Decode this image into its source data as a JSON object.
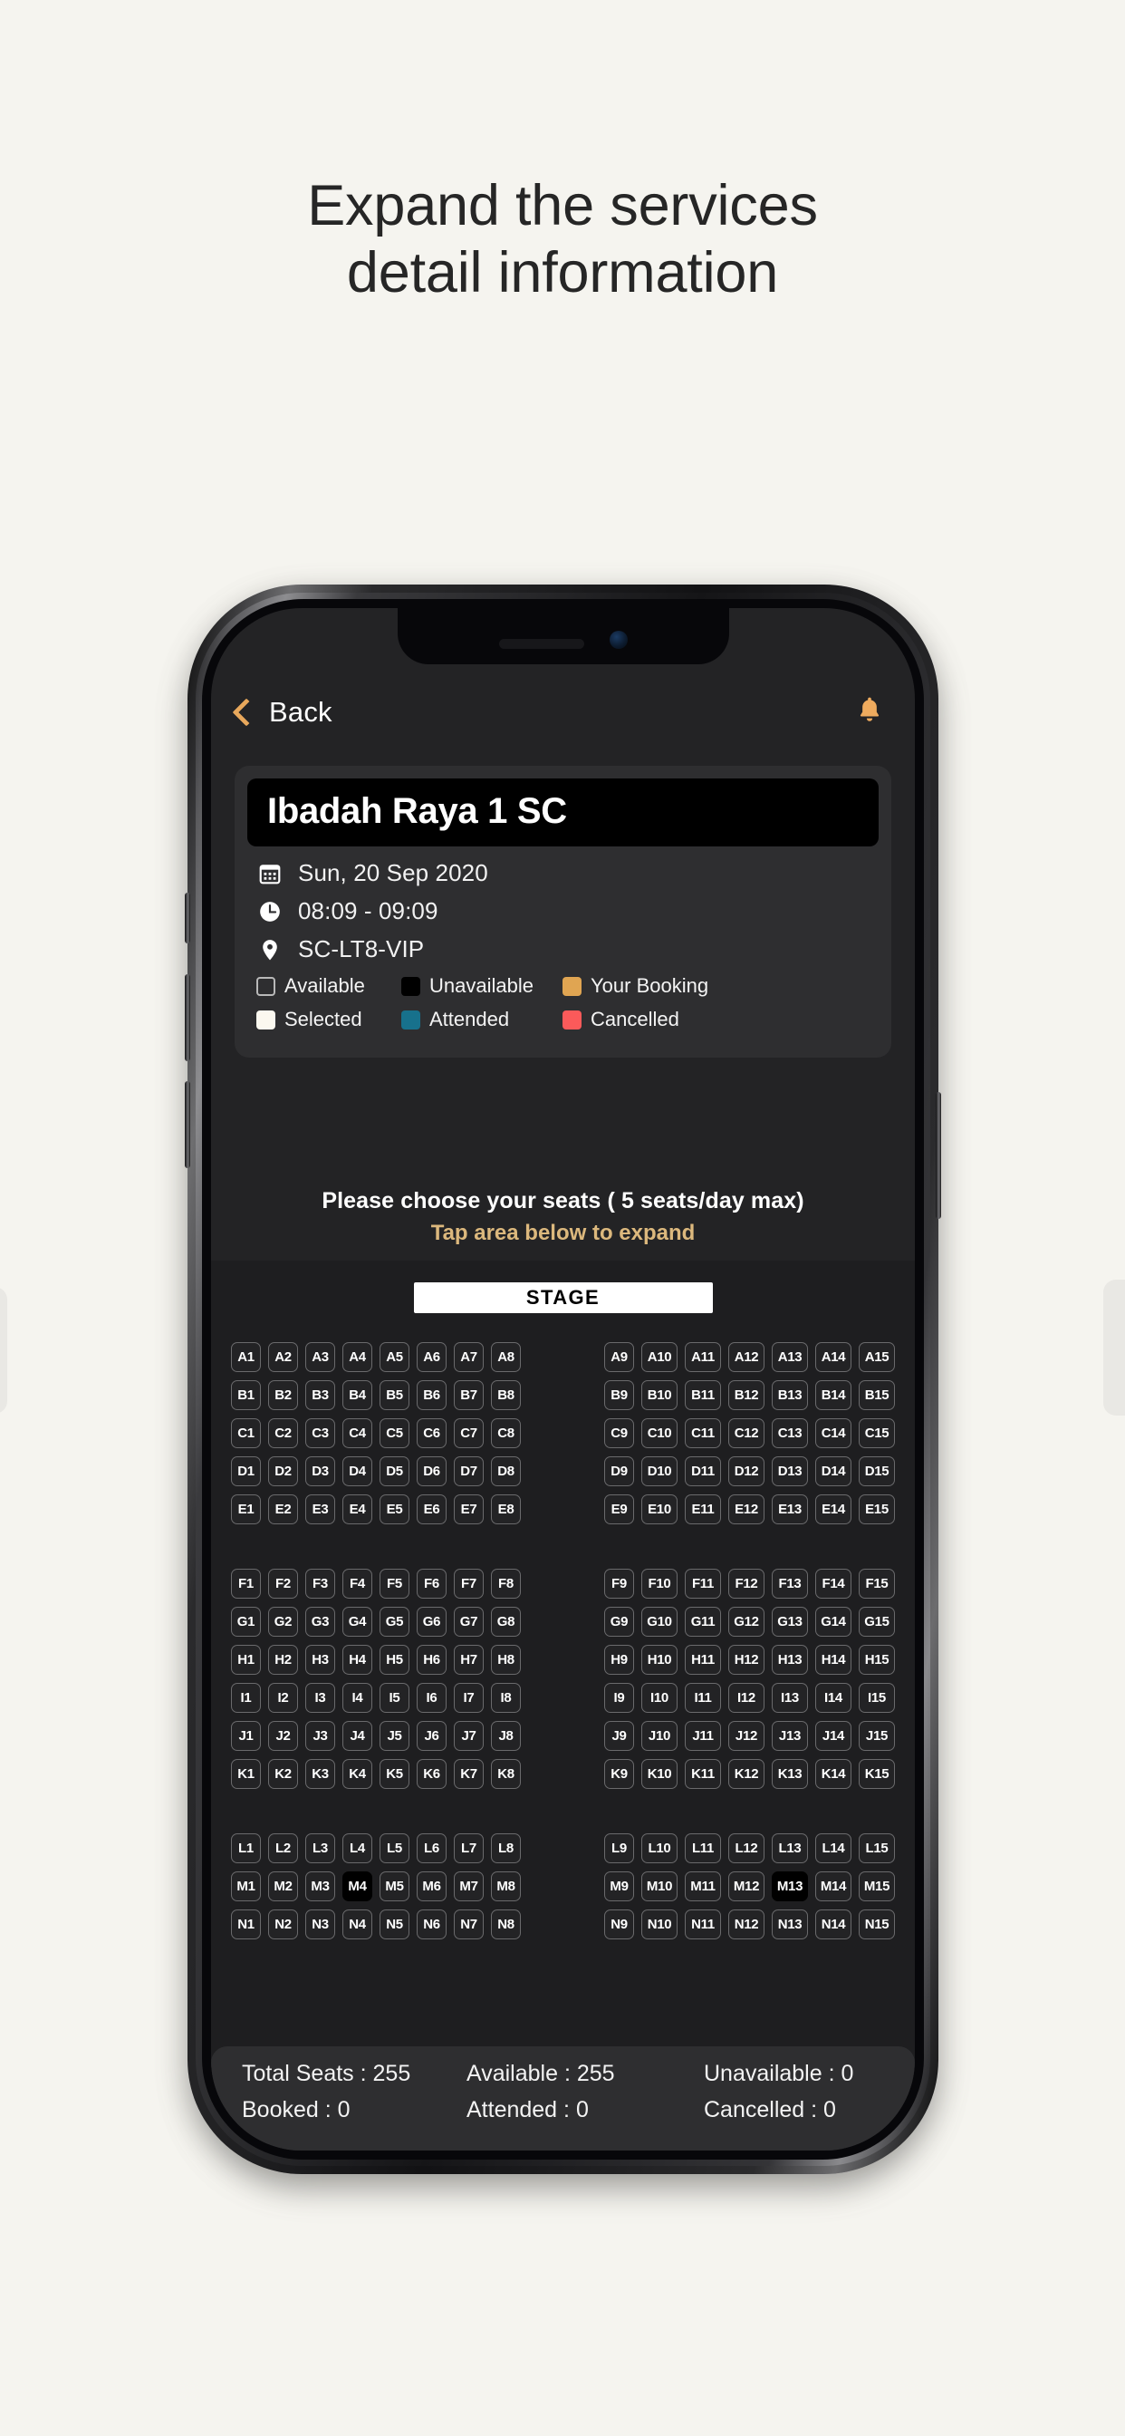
{
  "headline": {
    "line1": "Expand the services",
    "line2": "detail information"
  },
  "app": {
    "header": {
      "back_label": "Back",
      "back_icon": "chevron-left-icon",
      "notification_icon": "bell-icon",
      "accent_color": "#e8a85c"
    },
    "event": {
      "title": "Ibadah Raya 1 SC",
      "date": "Sun, 20 Sep 2020",
      "date_icon": "calendar-icon",
      "time": "08:09 - 09:09",
      "time_icon": "clock-icon",
      "location": "SC-LT8-VIP",
      "location_icon": "location-pin-icon"
    },
    "legend": [
      {
        "label": "Available",
        "color": "transparent",
        "border": "#b9b9b9"
      },
      {
        "label": "Unavailable",
        "color": "#000000",
        "border": "#000000"
      },
      {
        "label": "Your Booking",
        "color": "#e0a552",
        "border": "#e0a552"
      },
      {
        "label": "Selected",
        "color": "#fbf8ef",
        "border": "#fbf8ef"
      },
      {
        "label": "Attended",
        "color": "#17718c",
        "border": "#17718c"
      },
      {
        "label": "Cancelled",
        "color": "#fb5a5a",
        "border": "#fb5a5a"
      }
    ],
    "instructions": {
      "main": "Please choose your seats ( 5  seats/day max)",
      "sub": "Tap area below to expand"
    },
    "stage_label": "STAGE",
    "seat_map": {
      "left_columns": [
        1,
        2,
        3,
        4,
        5,
        6,
        7,
        8
      ],
      "right_columns": [
        9,
        10,
        11,
        12,
        13,
        14,
        15
      ],
      "row_groups": [
        {
          "rows": [
            "A",
            "B",
            "C",
            "D",
            "E"
          ]
        },
        {
          "rows": [
            "F",
            "G",
            "H",
            "I",
            "J",
            "K"
          ]
        },
        {
          "rows": [
            "L",
            "M",
            "N"
          ]
        }
      ],
      "unavailable_seats": [
        "M4",
        "M13"
      ]
    },
    "stats": [
      {
        "label": "Total Seats",
        "value": "255"
      },
      {
        "label": "Available",
        "value": "255"
      },
      {
        "label": "Unavailable",
        "value": "0"
      },
      {
        "label": "Booked",
        "value": "0"
      },
      {
        "label": "Attended",
        "value": "0"
      },
      {
        "label": "Cancelled",
        "value": "0"
      }
    ]
  }
}
